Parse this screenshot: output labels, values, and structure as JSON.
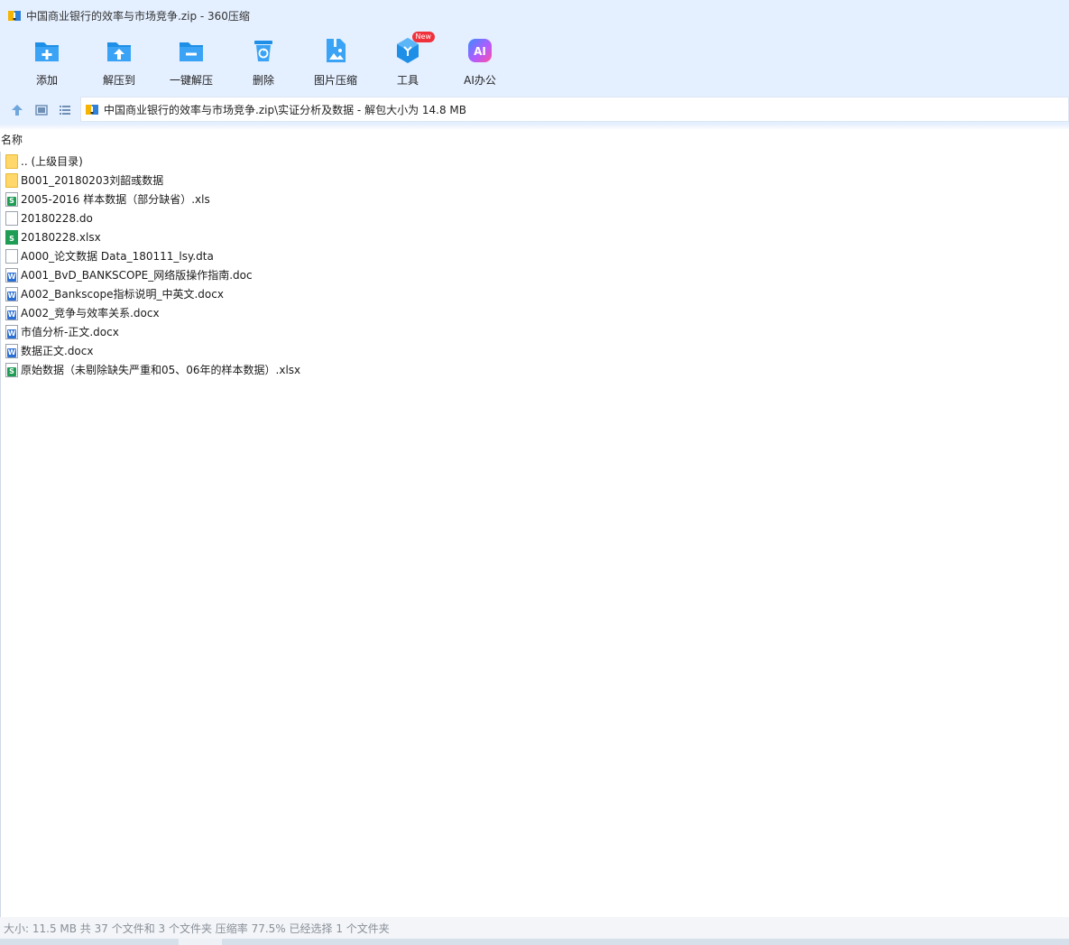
{
  "window": {
    "title": "中国商业银行的效率与市场竞争.zip - 360压缩"
  },
  "toolbar": {
    "items": [
      {
        "label": "添加",
        "icon": "add-icon"
      },
      {
        "label": "解压到",
        "icon": "extract-to-icon"
      },
      {
        "label": "一键解压",
        "icon": "one-click-extract-icon"
      },
      {
        "label": "删除",
        "icon": "delete-icon"
      },
      {
        "label": "图片压缩",
        "icon": "image-compress-icon"
      },
      {
        "label": "工具",
        "icon": "tools-icon",
        "badge": "New"
      },
      {
        "label": "AI办公",
        "icon": "ai-office-icon"
      }
    ]
  },
  "address": {
    "path": "中国商业银行的效率与市场竞争.zip\\实证分析及数据 - 解包大小为 14.8 MB"
  },
  "columns": {
    "name": "名称"
  },
  "files": [
    {
      "name": ".. (上级目录)",
      "type": "folder"
    },
    {
      "name": "B001_20180203刘韶彧数据",
      "type": "folder"
    },
    {
      "name": "2005-2016 样本数据（部分缺省）.xls",
      "type": "xls"
    },
    {
      "name": "20180228.do",
      "type": "file"
    },
    {
      "name": "20180228.xlsx",
      "type": "xlsx"
    },
    {
      "name": "A000_论文数据 Data_180111_lsy.dta",
      "type": "file"
    },
    {
      "name": "A001_BvD_BANKSCOPE_网络版操作指南.doc",
      "type": "doc"
    },
    {
      "name": "A002_Bankscope指标说明_中英文.docx",
      "type": "docx"
    },
    {
      "name": "A002_竞争与效率关系.docx",
      "type": "docx"
    },
    {
      "name": "市值分析-正文.docx",
      "type": "docx"
    },
    {
      "name": "数据正文.docx",
      "type": "docx"
    },
    {
      "name": "原始数据（未剔除缺失严重和05、06年的样本数据）.xlsx",
      "type": "xlsx"
    }
  ],
  "status": {
    "text": "大小: 11.5 MB 共 37 个文件和 3 个文件夹 压缩率 77.5% 已经选择 1 个文件夹"
  },
  "colors": {
    "toolbar_bg": "#e4efff",
    "accent": "#1e8fe6",
    "xls_green": "#1f9d55",
    "word_blue": "#2b6fd6",
    "folder_yellow": "#ffd76a"
  }
}
